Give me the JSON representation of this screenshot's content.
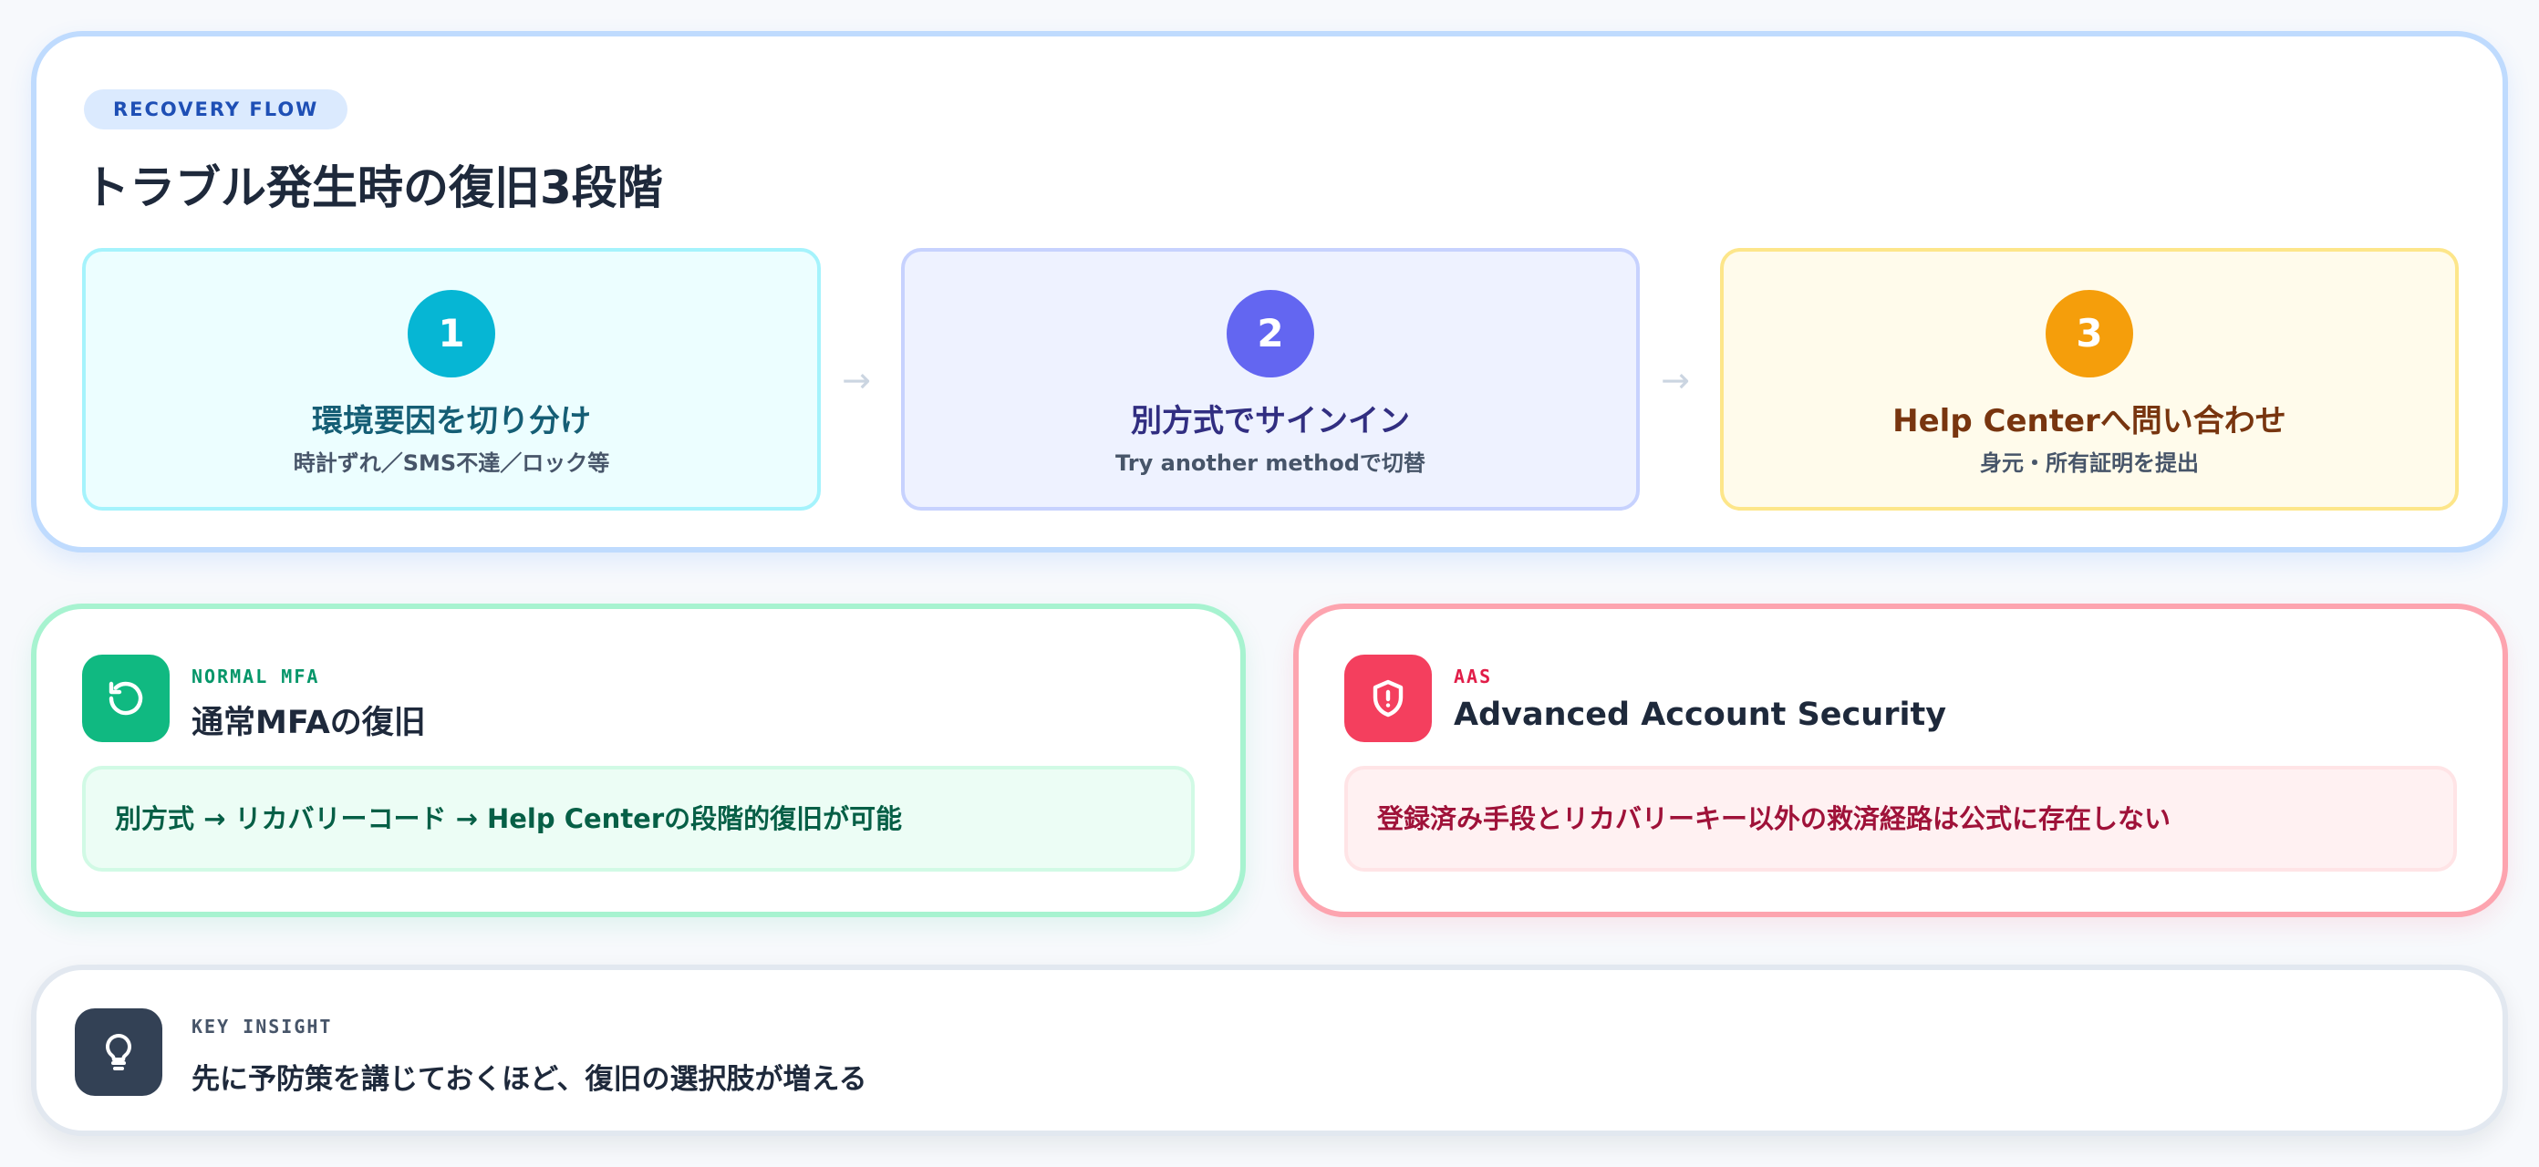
{
  "flow": {
    "tag": "RECOVERY FLOW",
    "title": "トラブル発生時の復旧3段階",
    "steps": [
      {
        "number": "1",
        "title": "環境要因を切り分け",
        "subtitle": "時計ずれ／SMS不達／ロック等",
        "color": "#06b6d4"
      },
      {
        "number": "2",
        "title": "別方式でサインイン",
        "subtitle": "Try another methodで切替",
        "color": "#6366f1"
      },
      {
        "number": "3",
        "title": "Help Centerへ問い合わせ",
        "subtitle": "身元・所有証明を提出",
        "color": "#f59e0b"
      }
    ],
    "arrow": "→"
  },
  "mfa": {
    "icon": "refresh-icon",
    "eyebrow": "NORMAL MFA",
    "title": "通常MFAの復旧",
    "note": "別方式 → リカバリーコード → Help Centerの段階的復旧が可能",
    "color": "#10b981"
  },
  "aas": {
    "icon": "shield-alert-icon",
    "eyebrow": "AAS",
    "title": "Advanced Account Security",
    "note": "登録済み手段とリカバリーキー以外の救済経路は公式に存在しない",
    "color": "#f43f5e"
  },
  "insight": {
    "icon": "lightbulb-icon",
    "eyebrow": "KEY INSIGHT",
    "text": "先に予防策を講じておくほど、復旧の選択肢が増える",
    "color": "#334155"
  }
}
